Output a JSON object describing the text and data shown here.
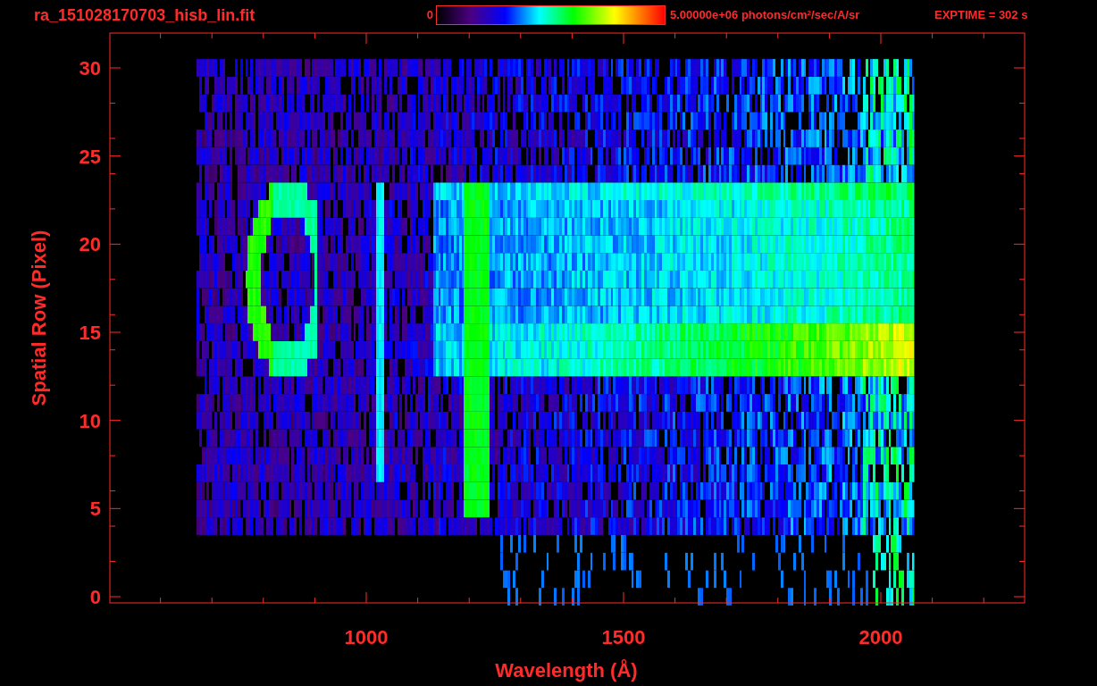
{
  "title": "ra_151028170703_hisb_lin.fit",
  "colorbar": {
    "min_label": "0",
    "max_label": "5.00000e+06 photons/cm$^{2}$/sec/A/sr"
  },
  "exptime": "EXPTIME = 302 s",
  "plot": {
    "xlabel": "Wavelength (Å)",
    "ylabel": "Spatial Row (Pixel)",
    "xtick_labels": [
      "1000",
      "1500",
      "2000"
    ],
    "ytick_labels": [
      "30",
      "25",
      "20",
      "15",
      "10",
      "5",
      "0"
    ]
  }
}
